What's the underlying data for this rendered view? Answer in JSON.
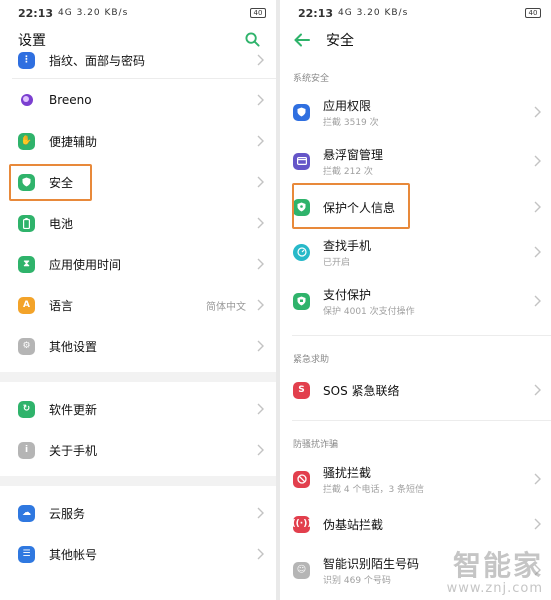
{
  "left": {
    "status": {
      "time": "22:13",
      "signal": "4G 3.20 KB/s",
      "battery": "40"
    },
    "title": "设置",
    "items": [
      {
        "label": "指纹、面部与密码",
        "icon": "fingerprint-icon",
        "color": "#2f6fe0"
      },
      {
        "label": "Breeno",
        "icon": "breeno-icon",
        "color": "#6b3fc8"
      },
      {
        "label": "便捷辅助",
        "icon": "hand-icon",
        "color": "#2fb36b"
      },
      {
        "label": "安全",
        "icon": "shield-icon",
        "color": "#2fb36b"
      },
      {
        "label": "电池",
        "icon": "battery-icon",
        "color": "#2fb36b"
      },
      {
        "label": "应用使用时间",
        "icon": "hourglass-icon",
        "color": "#2fb36b"
      },
      {
        "label": "语言",
        "value": "简体中文",
        "icon": "language-icon",
        "color": "#f3a329"
      },
      {
        "label": "其他设置",
        "icon": "gear-icon",
        "color": "#9b9b9b"
      },
      {
        "label": "软件更新",
        "icon": "update-icon",
        "color": "#2fb36b"
      },
      {
        "label": "关于手机",
        "icon": "info-icon",
        "color": "#9b9b9b"
      },
      {
        "label": "云服务",
        "icon": "cloud-icon",
        "color": "#2f78e0"
      },
      {
        "label": "其他帐号",
        "icon": "account-icon",
        "color": "#2f78e0"
      }
    ]
  },
  "right": {
    "status": {
      "time": "22:13",
      "signal": "4G 3.20 KB/s",
      "battery": "40"
    },
    "title": "安全",
    "sections": [
      "系统安全",
      "紧急求助",
      "防骚扰诈骗"
    ],
    "items": [
      {
        "label": "应用权限",
        "sub": "拦截 3519 次",
        "icon": "shield-icon",
        "color": "#2f6fe0"
      },
      {
        "label": "悬浮窗管理",
        "sub": "拦截 212 次",
        "icon": "window-icon",
        "color": "#6555c8"
      },
      {
        "label": "保护个人信息",
        "sub": "",
        "icon": "privacy-icon",
        "color": "#2fb36b"
      },
      {
        "label": "查找手机",
        "sub": "已开启",
        "icon": "compass-icon",
        "color": "#27b9c9"
      },
      {
        "label": "支付保护",
        "sub": "保护 4001 次支付操作",
        "icon": "payment-shield-icon",
        "color": "#2fb36b"
      },
      {
        "label": "SOS 紧急联络",
        "sub": "",
        "icon": "sos-icon",
        "color": "#e23f4d"
      },
      {
        "label": "骚扰拦截",
        "sub": "拦截 4 个电话，3 条短信",
        "icon": "block-icon",
        "color": "#e23f4d"
      },
      {
        "label": "伪基站拦截",
        "sub": "",
        "icon": "signal-icon",
        "color": "#e23f4d"
      },
      {
        "label": "智能识别陌生号码",
        "sub": "识别 469 个号码",
        "icon": "contact-icon",
        "color": "#9b9b9b"
      }
    ]
  },
  "watermark": {
    "cn": "智能家",
    "url": "www.znj.com"
  }
}
